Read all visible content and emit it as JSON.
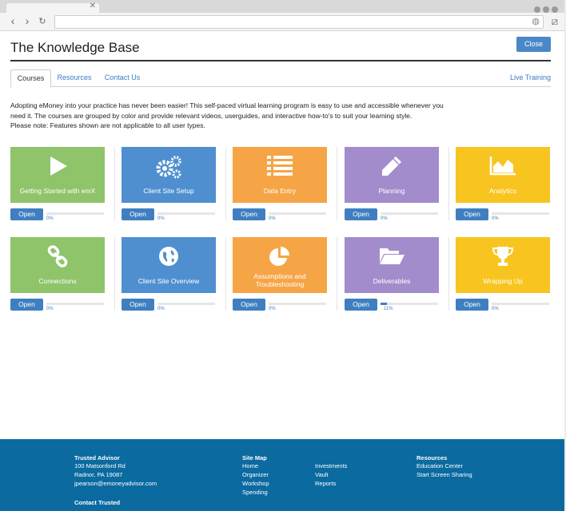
{
  "window": {
    "url": ""
  },
  "header": {
    "title": "The Knowledge Base",
    "close_label": "Close"
  },
  "tabs": {
    "courses": "Courses",
    "resources": "Resources",
    "contact": "Contact Us",
    "live_training": "Live Training"
  },
  "intro": {
    "line1": "Adopting eMoney into your practice has never been easier! This self-paced virtual learning program is easy to use and accessible whenever you",
    "line2": "need it. The courses are grouped by color and provide relevant videos, userguides, and interactive how-to's to suit your learning style.",
    "line3": "Please note: Features shown are not applicable to all user types."
  },
  "courses": [
    {
      "label": "Getting Started with emX",
      "icon": "play-icon",
      "color": "#8fc46a",
      "open": "Open",
      "progress": "0%",
      "progress_fraction": 0
    },
    {
      "label": "Client Site Setup",
      "icon": "gears-icon",
      "color": "#4f8fd0",
      "open": "Open",
      "progress": "0%",
      "progress_fraction": 0
    },
    {
      "label": "Data Entry",
      "icon": "list-icon",
      "color": "#f6a546",
      "open": "Open",
      "progress": "0%",
      "progress_fraction": 0
    },
    {
      "label": "Planning",
      "icon": "pencil-icon",
      "color": "#a38ccc",
      "open": "Open",
      "progress": "0%",
      "progress_fraction": 0
    },
    {
      "label": "Analytics",
      "icon": "area-chart-icon",
      "color": "#f8c520",
      "open": "Open",
      "progress": "0%",
      "progress_fraction": 0
    },
    {
      "label": "Connections",
      "icon": "link-icon",
      "color": "#8fc46a",
      "open": "Open",
      "progress": "0%",
      "progress_fraction": 0
    },
    {
      "label": "Client Site Overview",
      "icon": "globe-icon",
      "color": "#4f8fd0",
      "open": "Open",
      "progress": "0%",
      "progress_fraction": 0
    },
    {
      "label": "Assumptions and Troubleshooting",
      "icon": "pie-chart-icon",
      "color": "#f6a546",
      "open": "Open",
      "progress": "0%",
      "progress_fraction": 0
    },
    {
      "label": "Deliverables",
      "icon": "folder-icon",
      "color": "#a38ccc",
      "open": "Open",
      "progress": "11%",
      "progress_fraction": 0.11
    },
    {
      "label": "Wrapping Up",
      "icon": "trophy-icon",
      "color": "#f8c520",
      "open": "Open",
      "progress": "0%",
      "progress_fraction": 0
    }
  ],
  "footer": {
    "advisor": {
      "heading": "Trusted Advisor",
      "address1": "100 Matsonford Rd",
      "address2": "Radnor, PA 19087",
      "email": "jpearson@emoneyadvisor.com",
      "contact": "Contact Trusted"
    },
    "sitemap": {
      "heading": "Site Map",
      "col1": [
        "Home",
        "Organizer",
        "Workshop",
        "Spending"
      ],
      "col2": [
        "Investments",
        "Vault",
        "Reports"
      ]
    },
    "resources": {
      "heading": "Resources",
      "links": [
        "Education Center",
        "Start Screen Sharing"
      ]
    }
  }
}
